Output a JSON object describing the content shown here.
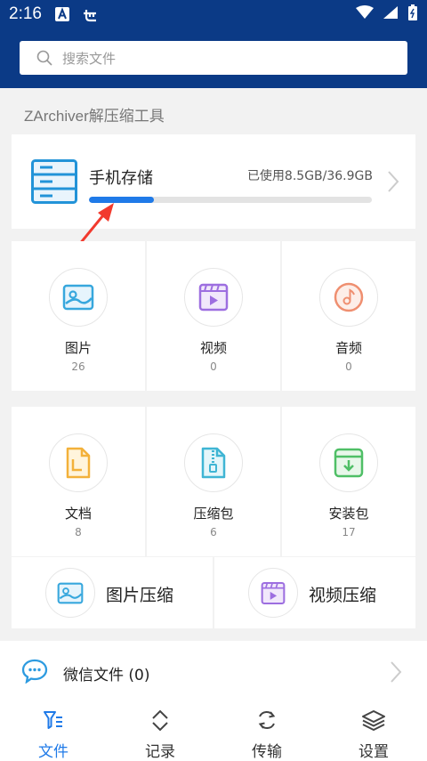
{
  "statusbar": {
    "time": "2:16"
  },
  "search": {
    "placeholder": "搜索文件"
  },
  "app_title": "ZArchiver解压缩工具",
  "storage": {
    "label": "手机存储",
    "usage": "已使用8.5GB/36.9GB",
    "used_fraction": 0.23
  },
  "categories": [
    {
      "name": "图片",
      "count": "26"
    },
    {
      "name": "视频",
      "count": "0"
    },
    {
      "name": "音频",
      "count": "0"
    },
    {
      "name": "文档",
      "count": "8"
    },
    {
      "name": "压缩包",
      "count": "6"
    },
    {
      "name": "安装包",
      "count": "17"
    }
  ],
  "compress": [
    {
      "label": "图片压缩"
    },
    {
      "label": "视频压缩"
    }
  ],
  "wechat": {
    "label": "微信文件 (0)"
  },
  "nav": [
    {
      "label": "文件"
    },
    {
      "label": "记录"
    },
    {
      "label": "传输"
    },
    {
      "label": "设置"
    }
  ],
  "colors": {
    "header": "#0b3a86",
    "accent": "#1f7ae8"
  }
}
